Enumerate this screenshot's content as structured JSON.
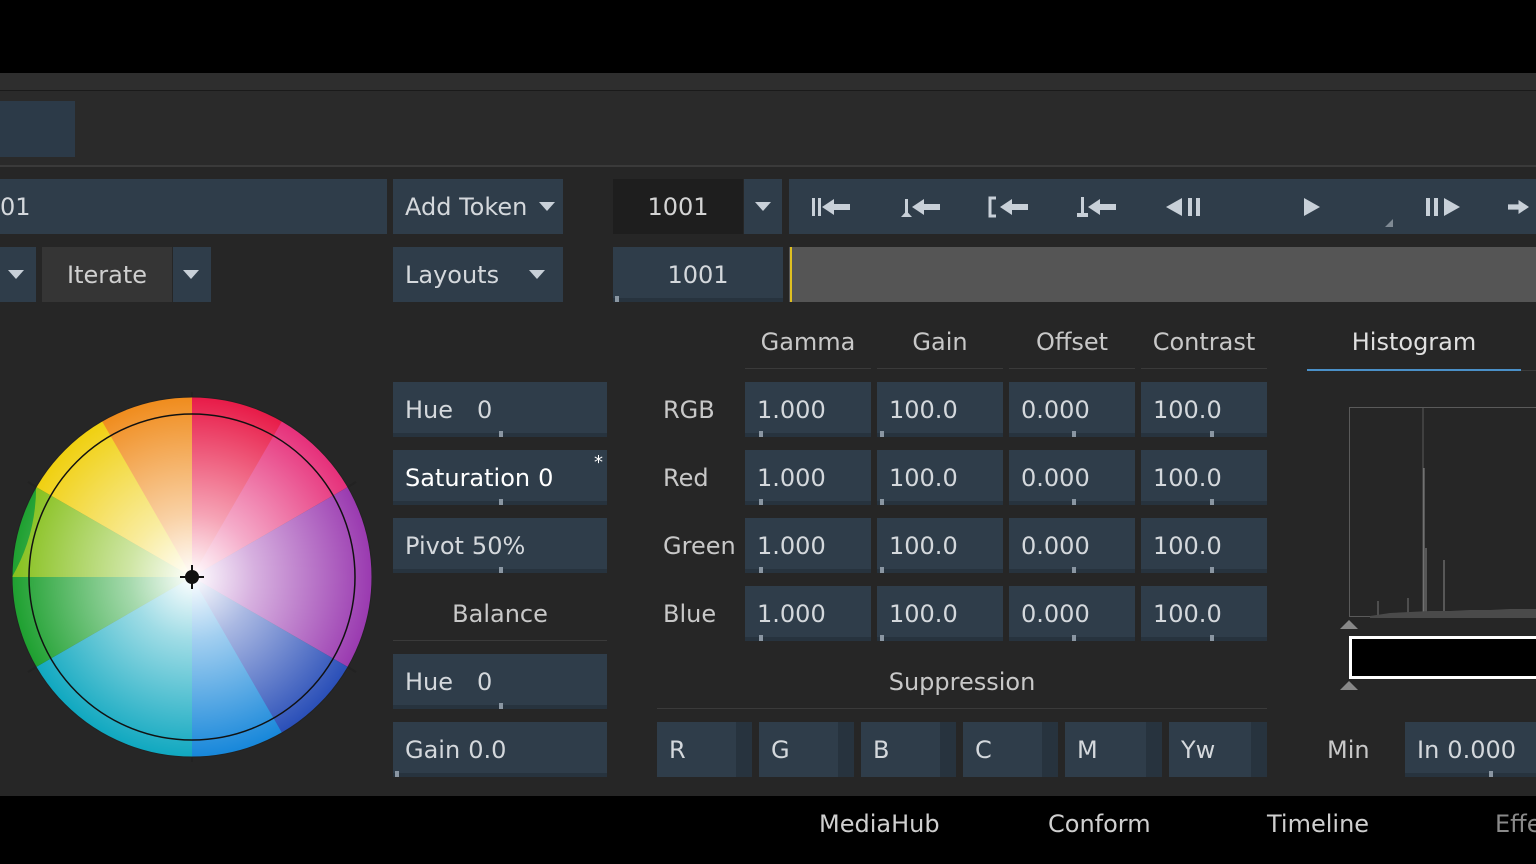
{
  "toolbar": {
    "name_value": "01",
    "add_token_label": "Add Token",
    "iterate_label": "Iterate",
    "layouts_label": "Layouts"
  },
  "transport": {
    "frame_value": "1001",
    "timeline_frame": "1001",
    "buttons": [
      "goto-start",
      "prev-keyframe",
      "mark-in",
      "prev-edit",
      "step-back",
      "play",
      "step-forward",
      "goto-end"
    ]
  },
  "hsp": {
    "hue_label": "Hue",
    "hue_value": "0",
    "saturation_label": "Saturation",
    "saturation_value": "0",
    "saturation_flag": "*",
    "pivot_label": "Pivot",
    "pivot_value": "50%"
  },
  "balance": {
    "title": "Balance",
    "hue_label": "Hue",
    "hue_value": "0",
    "gain_label": "Gain",
    "gain_value": "0.0"
  },
  "grade": {
    "columns": [
      "Gamma",
      "Gain",
      "Offset",
      "Contrast"
    ],
    "rows": [
      {
        "label": "RGB",
        "values": [
          "1.000",
          "100.0",
          "0.000",
          "100.0"
        ]
      },
      {
        "label": "Red",
        "values": [
          "1.000",
          "100.0",
          "0.000",
          "100.0"
        ]
      },
      {
        "label": "Green",
        "values": [
          "1.000",
          "100.0",
          "0.000",
          "100.0"
        ]
      },
      {
        "label": "Blue",
        "values": [
          "1.000",
          "100.0",
          "0.000",
          "100.0"
        ]
      }
    ]
  },
  "suppression": {
    "title": "Suppression",
    "channels": [
      "R",
      "G",
      "B",
      "C",
      "M",
      "Yw"
    ]
  },
  "histogram": {
    "tab_label": "Histogram",
    "min_label": "Min",
    "in_label": "In",
    "in_value": "0.000"
  },
  "bottom_nav": {
    "items": [
      "MediaHub",
      "Conform",
      "Timeline",
      "Effe"
    ]
  },
  "colors": {
    "field_bg": "#2f3d4a",
    "panel_bg": "#262626",
    "accent_line": "#4a90c8",
    "playhead": "#e0c020"
  }
}
